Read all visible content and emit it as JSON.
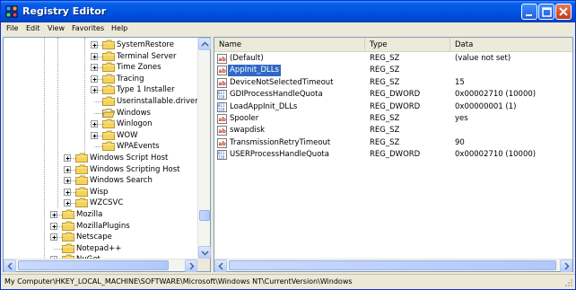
{
  "window": {
    "title": "Registry Editor"
  },
  "menu": [
    "File",
    "Edit",
    "View",
    "Favorites",
    "Help"
  ],
  "tree": [
    {
      "label": "SystemRestore",
      "expander": "plus",
      "level": 3
    },
    {
      "label": "Terminal Server",
      "expander": "plus",
      "level": 3
    },
    {
      "label": "Time Zones",
      "expander": "plus",
      "level": 3
    },
    {
      "label": "Tracing",
      "expander": "plus",
      "level": 3
    },
    {
      "label": "Type 1 Installer",
      "expander": "plus",
      "level": 3
    },
    {
      "label": "Userinstallable.drivers",
      "expander": "none",
      "level": 3
    },
    {
      "label": "Windows",
      "expander": "none",
      "level": 3,
      "open": true
    },
    {
      "label": "Winlogon",
      "expander": "plus",
      "level": 3
    },
    {
      "label": "WOW",
      "expander": "plus",
      "level": 3
    },
    {
      "label": "WPAEvents",
      "expander": "none",
      "level": 3
    },
    {
      "label": "Windows Script Host",
      "expander": "plus",
      "level": 2
    },
    {
      "label": "Windows Scripting Host",
      "expander": "plus",
      "level": 2
    },
    {
      "label": "Windows Search",
      "expander": "plus",
      "level": 2
    },
    {
      "label": "Wisp",
      "expander": "plus",
      "level": 2
    },
    {
      "label": "WZCSVC",
      "expander": "plus",
      "level": 2
    },
    {
      "label": "Mozilla",
      "expander": "plus",
      "level": 1
    },
    {
      "label": "MozillaPlugins",
      "expander": "plus",
      "level": 1
    },
    {
      "label": "Netscape",
      "expander": "plus",
      "level": 1
    },
    {
      "label": "Notepad++",
      "expander": "none",
      "level": 1
    },
    {
      "label": "NuGet",
      "expander": "plus",
      "level": 1
    }
  ],
  "list": {
    "columns": [
      "Name",
      "Type",
      "Data"
    ],
    "rows": [
      {
        "name": "(Default)",
        "type": "REG_SZ",
        "data": "(value not set)",
        "icon": "string-value-icon"
      },
      {
        "name": "AppInit_DLLs",
        "type": "REG_SZ",
        "data": "",
        "icon": "string-value-icon",
        "selected": true
      },
      {
        "name": "DeviceNotSelectedTimeout",
        "type": "REG_SZ",
        "data": "15",
        "icon": "string-value-icon"
      },
      {
        "name": "GDIProcessHandleQuota",
        "type": "REG_DWORD",
        "data": "0x00002710 (10000)",
        "icon": "binary-value-icon"
      },
      {
        "name": "LoadAppInit_DLLs",
        "type": "REG_DWORD",
        "data": "0x00000001 (1)",
        "icon": "binary-value-icon"
      },
      {
        "name": "Spooler",
        "type": "REG_SZ",
        "data": "yes",
        "icon": "string-value-icon"
      },
      {
        "name": "swapdisk",
        "type": "REG_SZ",
        "data": "",
        "icon": "string-value-icon"
      },
      {
        "name": "TransmissionRetryTimeout",
        "type": "REG_SZ",
        "data": "90",
        "icon": "string-value-icon"
      },
      {
        "name": "USERProcessHandleQuota",
        "type": "REG_DWORD",
        "data": "0x00002710 (10000)",
        "icon": "binary-value-icon"
      }
    ]
  },
  "status": "My Computer\\HKEY_LOCAL_MACHINE\\SOFTWARE\\Microsoft\\Windows NT\\CurrentVersion\\Windows",
  "colors": {
    "title_blue": "#0054e3",
    "selection": "#316ac5",
    "folder_yellow": "#f5d35c"
  }
}
